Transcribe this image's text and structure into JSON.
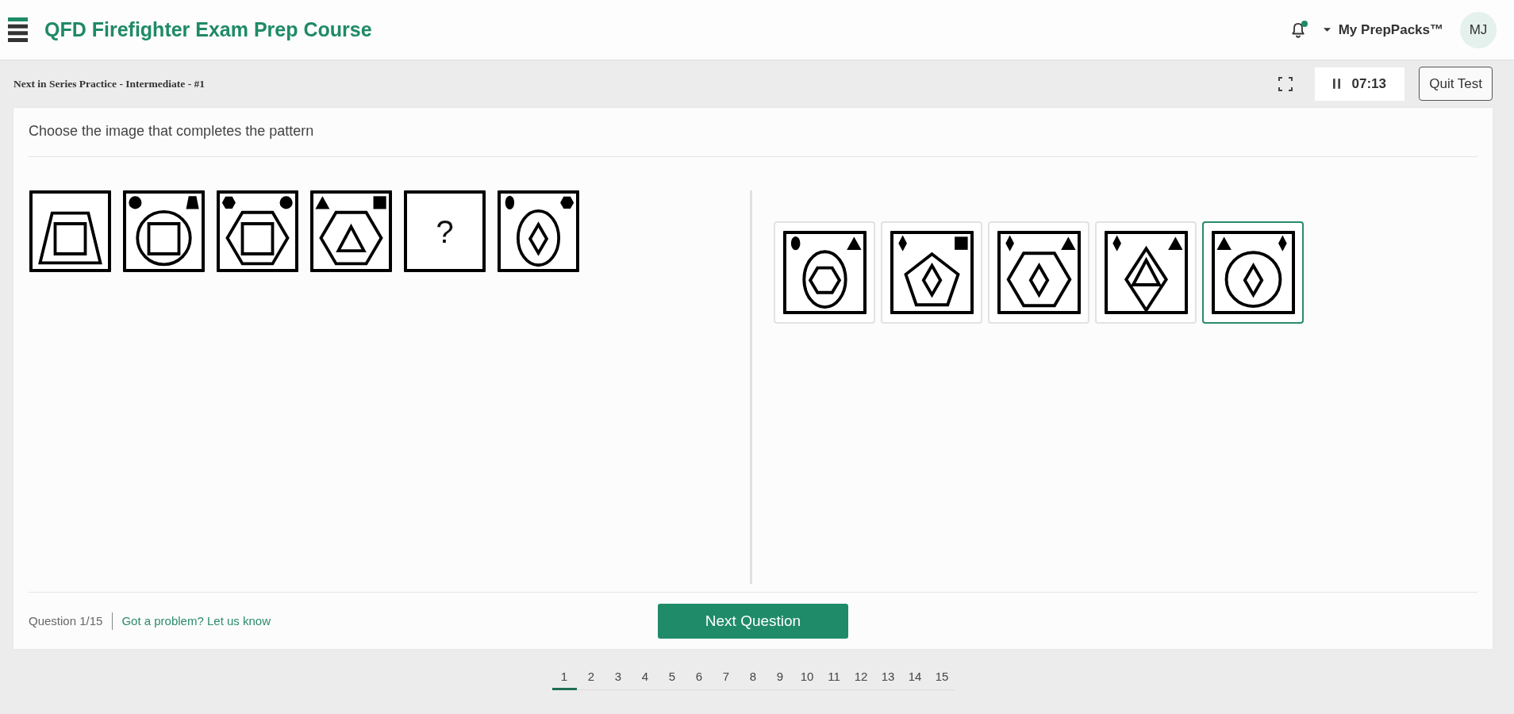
{
  "header": {
    "title": "QFD Firefighter Exam Prep Course",
    "unread": true,
    "menu": "My PrepPacks™",
    "avatar": "MJ"
  },
  "test_bar": {
    "title": "Next in Series Practice - Intermediate - #1",
    "timer": "07:13",
    "quit_button": "Quit Test"
  },
  "question": {
    "prompt": "Choose the image that completes the pattern",
    "series": [
      {
        "kind": "figure",
        "outer": {
          "kind": "trapezoid"
        },
        "inner": {
          "kind": "square"
        }
      },
      {
        "kind": "figure",
        "top_left": {
          "kind": "circle"
        },
        "top_right": {
          "kind": "trapezoid"
        },
        "outer": {
          "kind": "circle"
        },
        "inner": {
          "kind": "square"
        }
      },
      {
        "kind": "figure",
        "top_left": {
          "kind": "hexagon"
        },
        "top_right": {
          "kind": "circle"
        },
        "outer": {
          "kind": "hexagon"
        },
        "inner": {
          "kind": "square"
        }
      },
      {
        "kind": "figure",
        "top_left": {
          "kind": "triangle"
        },
        "top_right": {
          "kind": "square"
        },
        "outer": {
          "kind": "hexagon"
        },
        "inner": {
          "kind": "triangle"
        }
      },
      {
        "kind": "blank",
        "text": "?"
      },
      {
        "kind": "figure",
        "top_left": {
          "kind": "ellipse"
        },
        "top_right": {
          "kind": "hexagon"
        },
        "outer": {
          "kind": "ellipse"
        },
        "inner": {
          "kind": "diamond"
        }
      }
    ],
    "options": [
      {
        "top_left": {
          "kind": "ellipse"
        },
        "top_right": {
          "kind": "triangle"
        },
        "outer": {
          "kind": "ellipse"
        },
        "inner": {
          "kind": "hexagon"
        },
        "selected": false
      },
      {
        "top_left": {
          "kind": "diamond"
        },
        "top_right": {
          "kind": "square"
        },
        "outer": {
          "kind": "pentagon"
        },
        "inner": {
          "kind": "diamond"
        },
        "selected": false
      },
      {
        "top_left": {
          "kind": "diamond"
        },
        "top_right": {
          "kind": "triangle"
        },
        "outer": {
          "kind": "hexagon"
        },
        "inner": {
          "kind": "diamond"
        },
        "selected": false
      },
      {
        "top_left": {
          "kind": "diamond"
        },
        "top_right": {
          "kind": "triangle"
        },
        "outer": {
          "kind": "diamond"
        },
        "inner": {
          "kind": "triangle"
        },
        "selected": false
      },
      {
        "top_left": {
          "kind": "triangle"
        },
        "top_right": {
          "kind": "diamond"
        },
        "outer": {
          "kind": "circle"
        },
        "inner": {
          "kind": "diamond"
        },
        "selected": true
      }
    ]
  },
  "footer": {
    "counter": "Question 1/15",
    "report_link": "Got a problem? Let us know",
    "next_button": "Next Question"
  },
  "pagination": [
    {
      "label": "1",
      "selected": true
    },
    {
      "label": "2",
      "selected": false
    },
    {
      "label": "3",
      "selected": false
    },
    {
      "label": "4",
      "selected": false
    },
    {
      "label": "5",
      "selected": false
    },
    {
      "label": "6",
      "selected": false
    },
    {
      "label": "7",
      "selected": false
    },
    {
      "label": "8",
      "selected": false
    },
    {
      "label": "9",
      "selected": false
    },
    {
      "label": "10",
      "selected": false
    },
    {
      "label": "11",
      "selected": false
    },
    {
      "label": "12",
      "selected": false
    },
    {
      "label": "13",
      "selected": false
    },
    {
      "label": "14",
      "selected": false
    },
    {
      "label": "15",
      "selected": false
    }
  ]
}
